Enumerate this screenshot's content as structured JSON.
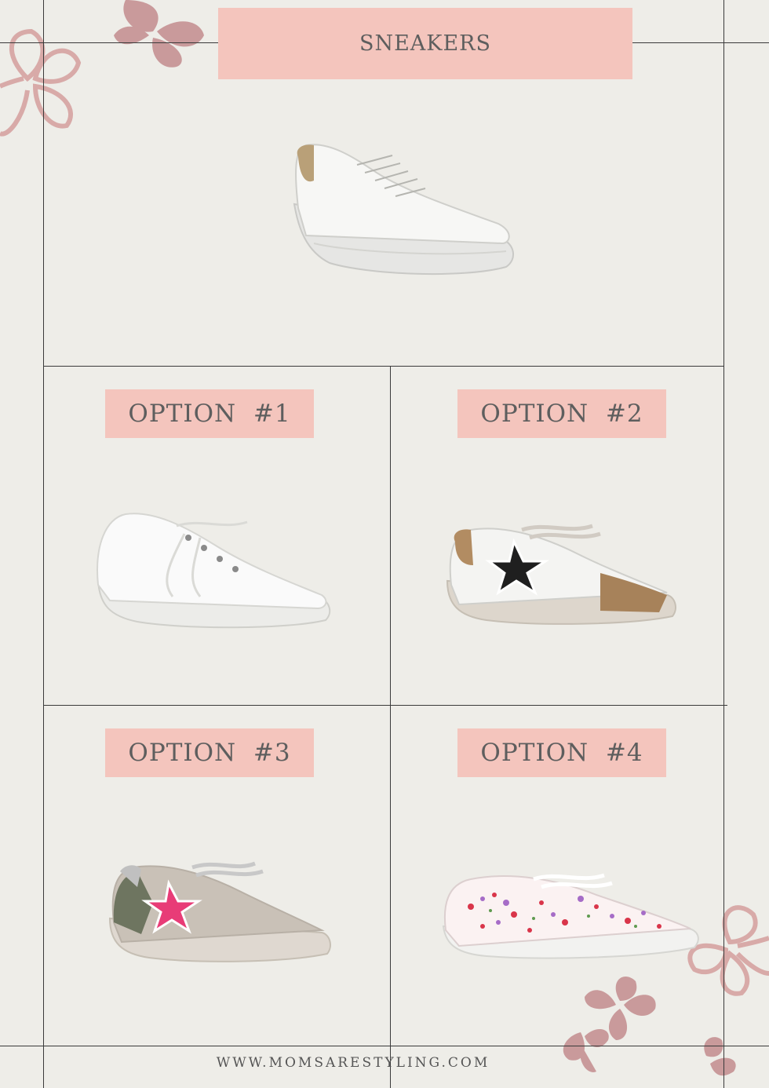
{
  "page": {
    "title": "SNEAKERS",
    "footer": "WWW.MOMSARESTYLING.COM"
  },
  "options": [
    {
      "label": "OPTION  #1",
      "shoe": "white-canvas-slip-on-sneaker"
    },
    {
      "label": "OPTION  #2",
      "shoe": "white-leather-black-star-leopard-sneaker"
    },
    {
      "label": "OPTION  #3",
      "shoe": "camo-pink-star-sneaker"
    },
    {
      "label": "OPTION  #4",
      "shoe": "floral-print-sneaker"
    }
  ],
  "main_shoe": "white-leather-platform-sneaker",
  "colors": {
    "background": "#eeede8",
    "label": "#f4c5bd",
    "flower_dark": "#c99a9b",
    "flower_outline": "#d8aaa8"
  }
}
